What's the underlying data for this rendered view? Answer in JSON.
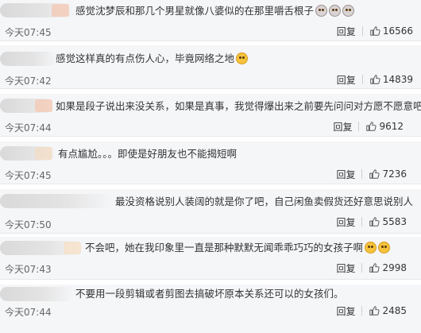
{
  "comments": [
    {
      "text": "感觉沈梦辰和那几个男星就像八婆似的在那里嚼舌根子",
      "emojis": [
        "grey",
        "grey",
        "grey"
      ],
      "time": "今天07:45",
      "reply_label": "回复",
      "likes": "16566"
    },
    {
      "text": "感觉这样真的有点伤人心，毕竟网络之地",
      "emojis": [
        "yellow"
      ],
      "time": "今天07:42",
      "reply_label": "回复",
      "likes": "14839"
    },
    {
      "text": "如果是段子说出来没关系，如果是真事，我觉得爆出来之前要先问问对方愿不愿意吧",
      "emojis": [],
      "time": "今天07:44",
      "reply_label": "回复",
      "likes": "9612"
    },
    {
      "text": "有点尴尬。。。即使是好朋友也不能揭短啊",
      "emojis": [],
      "time": "今天07:45",
      "reply_label": "回复",
      "likes": "7236"
    },
    {
      "text": "最没资格说别人装阔的就是你了吧，自己闲鱼卖假货还好意思说别人",
      "emojis": [],
      "time": "今天07:50",
      "reply_label": "回复",
      "likes": "5583"
    },
    {
      "text": "不会吧，她在我印象里一直是那种默默无闻乖乖巧巧的女孩子啊",
      "emojis": [
        "yellow",
        "yellow"
      ],
      "time": "今天07:43",
      "reply_label": "回复",
      "likes": "2998"
    },
    {
      "text": "不要用一段剪辑或者剪图去搞破坏原本关系还可以的女孩们。",
      "emojis": [],
      "time": "今天07:44",
      "reply_label": "回复",
      "likes": "2485"
    }
  ],
  "colors": {
    "background": "#f5f6f8",
    "text": "#333333",
    "meta": "#666666"
  }
}
